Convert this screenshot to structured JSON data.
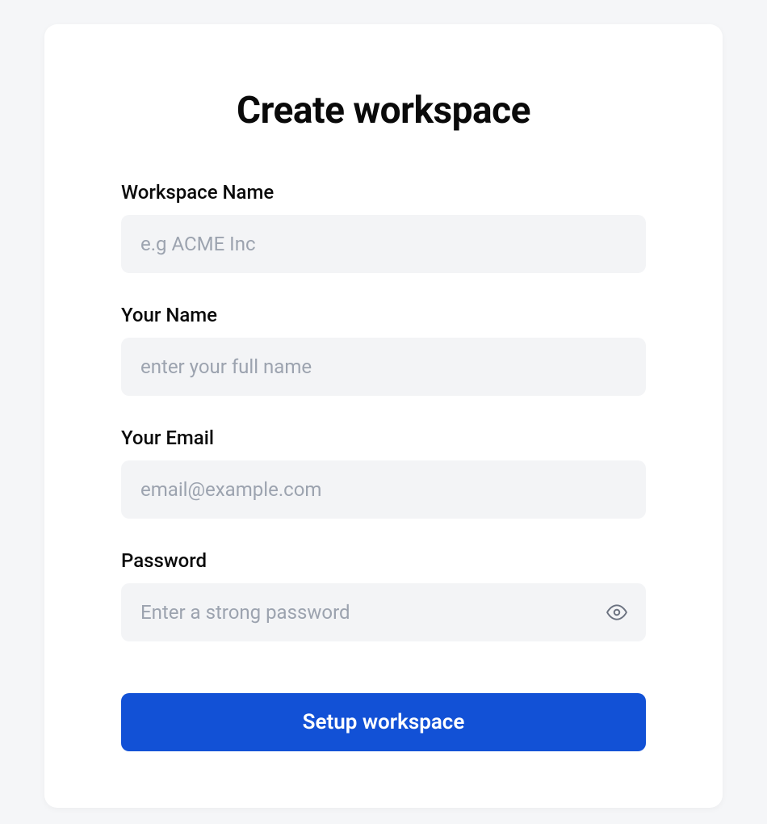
{
  "form": {
    "title": "Create workspace",
    "fields": {
      "workspace_name": {
        "label": "Workspace Name",
        "placeholder": "e.g ACME Inc",
        "value": ""
      },
      "your_name": {
        "label": "Your Name",
        "placeholder": "enter your full name",
        "value": ""
      },
      "your_email": {
        "label": "Your Email",
        "placeholder": "email@example.com",
        "value": ""
      },
      "password": {
        "label": "Password",
        "placeholder": "Enter a strong password",
        "value": ""
      }
    },
    "submit_label": "Setup workspace"
  },
  "colors": {
    "primary": "#1251d6",
    "input_bg": "#f3f4f6",
    "placeholder": "#9ca3af"
  }
}
